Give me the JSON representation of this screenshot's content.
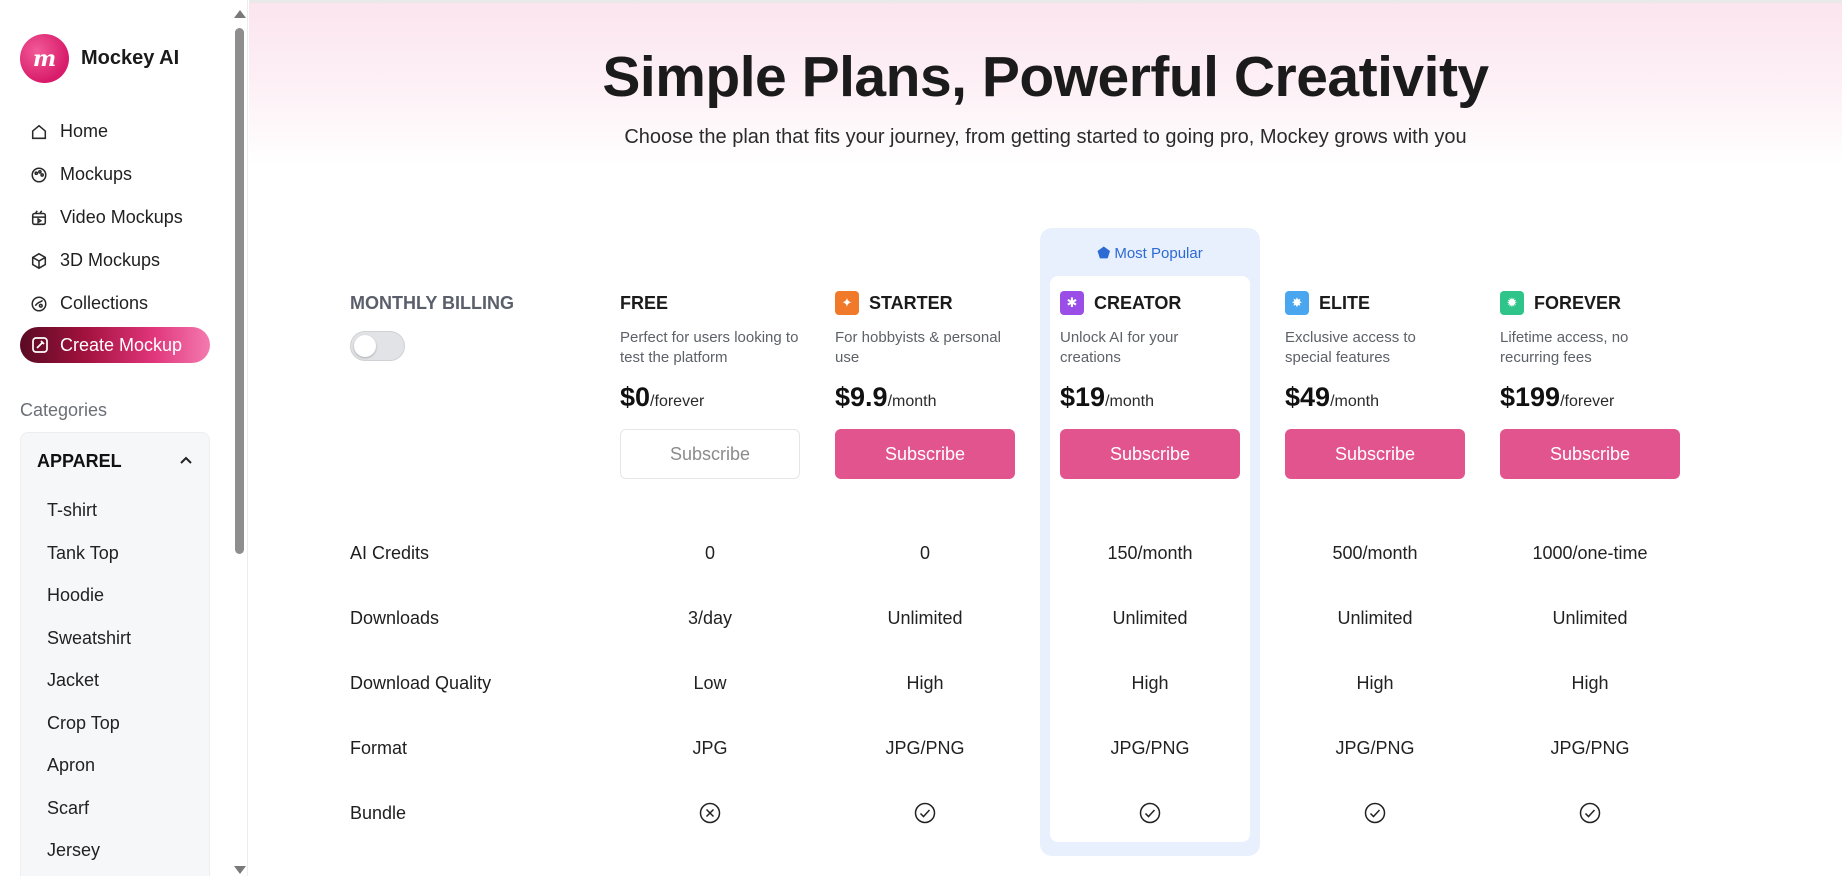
{
  "brand": {
    "name": "Mockey AI",
    "logo_letter": "m"
  },
  "nav": [
    {
      "label": "Home",
      "icon": "home-icon"
    },
    {
      "label": "Mockups",
      "icon": "palette-icon"
    },
    {
      "label": "Video Mockups",
      "icon": "video-icon"
    },
    {
      "label": "3D Mockups",
      "icon": "cube-icon"
    },
    {
      "label": "Collections",
      "icon": "collections-icon"
    }
  ],
  "create_button": {
    "label": "Create Mockup",
    "icon": "create-icon"
  },
  "categories": {
    "heading": "Categories",
    "group": "APPAREL",
    "items": [
      "T-shirt",
      "Tank Top",
      "Hoodie",
      "Sweatshirt",
      "Jacket",
      "Crop Top",
      "Apron",
      "Scarf",
      "Jersey"
    ]
  },
  "hero": {
    "title": "Simple Plans, Powerful Creativity",
    "subtitle": "Choose the plan that fits your journey, from getting started to going pro, Mockey grows with you"
  },
  "billing": {
    "label": "MONTHLY BILLING",
    "annual_enabled": false
  },
  "popular_badge": "Most Popular",
  "plans": [
    {
      "name": "FREE",
      "desc": "Perfect for users looking to test the platform",
      "price": "$0",
      "period": "/forever",
      "button": "Subscribe",
      "icon": "",
      "color": ""
    },
    {
      "name": "STARTER",
      "desc": "For hobbyists & personal use",
      "price": "$9.9",
      "period": "/month",
      "button": "Subscribe",
      "icon": "starter-icon",
      "color": "#f07a2a"
    },
    {
      "name": "CREATOR",
      "desc": "Unlock AI for your creations",
      "price": "$19",
      "period": "/month",
      "button": "Subscribe",
      "icon": "creator-icon",
      "color": "#9b4de8"
    },
    {
      "name": "ELITE",
      "desc": "Exclusive access to special features",
      "price": "$49",
      "period": "/month",
      "button": "Subscribe",
      "icon": "elite-icon",
      "color": "#4aa6ee"
    },
    {
      "name": "FOREVER",
      "desc": "Lifetime access, no recurring fees",
      "price": "$199",
      "period": "/forever",
      "button": "Subscribe",
      "icon": "forever-icon",
      "color": "#2fc58a"
    }
  ],
  "features": [
    {
      "label": "AI Credits",
      "values": [
        "0",
        "0",
        "150/month",
        "500/month",
        "1000/one-time"
      ]
    },
    {
      "label": "Downloads",
      "values": [
        "3/day",
        "Unlimited",
        "Unlimited",
        "Unlimited",
        "Unlimited"
      ]
    },
    {
      "label": "Download Quality",
      "values": [
        "Low",
        "High",
        "High",
        "High",
        "High"
      ]
    },
    {
      "label": "Format",
      "values": [
        "JPG",
        "JPG/PNG",
        "JPG/PNG",
        "JPG/PNG",
        "JPG/PNG"
      ]
    },
    {
      "label": "Bundle",
      "included": [
        false,
        true,
        true,
        true,
        true
      ]
    }
  ]
}
